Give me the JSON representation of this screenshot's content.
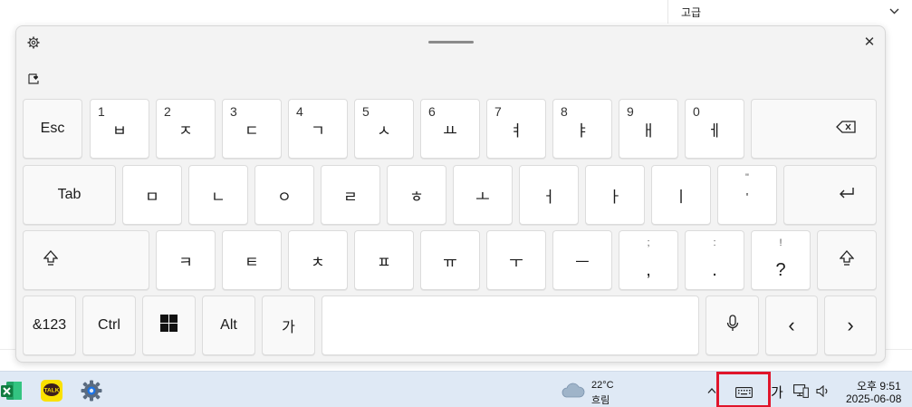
{
  "background": {
    "dropdown_label": "고급",
    "dropdown_icon": "chevron-down-icon"
  },
  "keyboard": {
    "row1": {
      "esc": "Esc",
      "keys": [
        {
          "num": "1",
          "char": "ㅂ"
        },
        {
          "num": "2",
          "char": "ㅈ"
        },
        {
          "num": "3",
          "char": "ㄷ"
        },
        {
          "num": "4",
          "char": "ㄱ"
        },
        {
          "num": "5",
          "char": "ㅅ"
        },
        {
          "num": "6",
          "char": "ㅛ"
        },
        {
          "num": "7",
          "char": "ㅕ"
        },
        {
          "num": "8",
          "char": "ㅑ"
        },
        {
          "num": "9",
          "char": "ㅐ"
        },
        {
          "num": "0",
          "char": "ㅔ"
        }
      ],
      "backspace_icon": "backspace-icon"
    },
    "row2": {
      "tab": "Tab",
      "keys": [
        "ㅁ",
        "ㄴ",
        "ㅇ",
        "ㄹ",
        "ㅎ",
        "ㅗ",
        "ㅓ",
        "ㅏ",
        "ㅣ"
      ],
      "quote_small": "\"",
      "quote_main": "'",
      "enter_icon": "enter-icon"
    },
    "row3": {
      "shift_icon": "shift-icon",
      "keys": [
        "ㅋ",
        "ㅌ",
        "ㅊ",
        "ㅍ",
        "ㅠ",
        "ㅜ",
        "ㅡ"
      ],
      "punct": [
        {
          "small": ";",
          "main": ","
        },
        {
          "small": ":",
          "main": "."
        },
        {
          "small": "!",
          "main": "?"
        }
      ]
    },
    "row4": {
      "symbols": "&123",
      "ctrl": "Ctrl",
      "windows_icon": "windows-icon",
      "alt": "Alt",
      "hangul": "가",
      "mic_icon": "microphone-icon",
      "left": "‹",
      "right": "›"
    }
  },
  "taskbar": {
    "apps": [
      "excel-icon",
      "kakaotalk-icon",
      "settings-icon"
    ],
    "kakao_label": "TALK",
    "weather_temp": "22°C",
    "weather_desc": "흐림",
    "tray_chevron": "^",
    "ime_label": "가",
    "clock_time": "오후 9:51",
    "clock_date": "2025-06-08",
    "highlight_color": "#e0152b"
  }
}
